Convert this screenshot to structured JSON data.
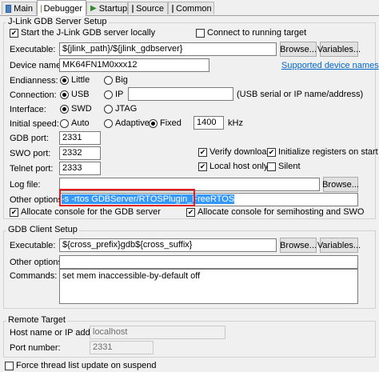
{
  "tabs": [
    {
      "label": "Main",
      "active": false
    },
    {
      "label": "Debugger",
      "active": true
    },
    {
      "label": "Startup",
      "active": false
    },
    {
      "label": "Source",
      "active": false
    },
    {
      "label": "Common",
      "active": false
    }
  ],
  "jlink": {
    "group_title": "J-Link GDB Server Setup",
    "start_server_label": "Start the J-Link GDB server locally",
    "start_server_checked": true,
    "connect_running_label": "Connect to running target",
    "connect_running_checked": false,
    "executable_label": "Executable:",
    "executable_value": "${jlink_path}/${jlink_gdbserver}",
    "browse_label": "Browse...",
    "variables_label": "Variables...",
    "device_name_label": "Device name:",
    "device_name_value": "MK64FN1M0xxx12",
    "supported_devices_link": "Supported device names",
    "endianness_label": "Endianness:",
    "endianness_options": [
      "Little",
      "Big"
    ],
    "endianness_selected": "Little",
    "connection_label": "Connection:",
    "connection_options": [
      "USB",
      "IP"
    ],
    "connection_selected": "USB",
    "connection_hint": "(USB serial or IP name/address)",
    "interface_label": "Interface:",
    "interface_options": [
      "SWD",
      "JTAG"
    ],
    "interface_selected": "SWD",
    "speed_label": "Initial speed:",
    "speed_options": [
      "Auto",
      "Adaptive",
      "Fixed"
    ],
    "speed_selected": "Fixed",
    "speed_value": "1400",
    "speed_unit": "kHz",
    "gdb_port_label": "GDB port:",
    "gdb_port_value": "2331",
    "swo_port_label": "SWO port:",
    "swo_port_value": "2332",
    "telnet_port_label": "Telnet port:",
    "telnet_port_value": "2333",
    "verify_label": "Verify downloads",
    "verify_checked": true,
    "init_regs_label": "Initialize registers on start",
    "init_regs_checked": true,
    "localhost_only_label": "Local host only",
    "localhost_only_checked": true,
    "silent_label": "Silent",
    "silent_checked": false,
    "log_file_label": "Log file:",
    "log_file_value": "",
    "other_options_label": "Other options:",
    "other_options_value": "-s -rtos GDBServer/RTOSPlugin_FreeRTOS",
    "alloc_gdb_console_label": "Allocate console for the GDB server",
    "alloc_gdb_console_checked": true,
    "alloc_swo_console_label": "Allocate console for semihosting and SWO",
    "alloc_swo_console_checked": true
  },
  "client": {
    "group_title": "GDB Client Setup",
    "executable_label": "Executable:",
    "executable_value": "${cross_prefix}gdb${cross_suffix}",
    "browse_label": "Browse...",
    "variables_label": "Variables...",
    "other_options_label": "Other options:",
    "other_options_value": "",
    "commands_label": "Commands:",
    "commands_value": "set mem inaccessible-by-default off"
  },
  "remote": {
    "group_title": "Remote Target",
    "host_label": "Host name or IP address:",
    "host_value": "localhost",
    "port_label": "Port number:",
    "port_value": "2331"
  },
  "force_thread_label": "Force thread list update on suspend",
  "force_thread_checked": false,
  "colors": {
    "link": "#0066cc",
    "selection": "#3399ff",
    "highlight_box": "#e02020"
  }
}
